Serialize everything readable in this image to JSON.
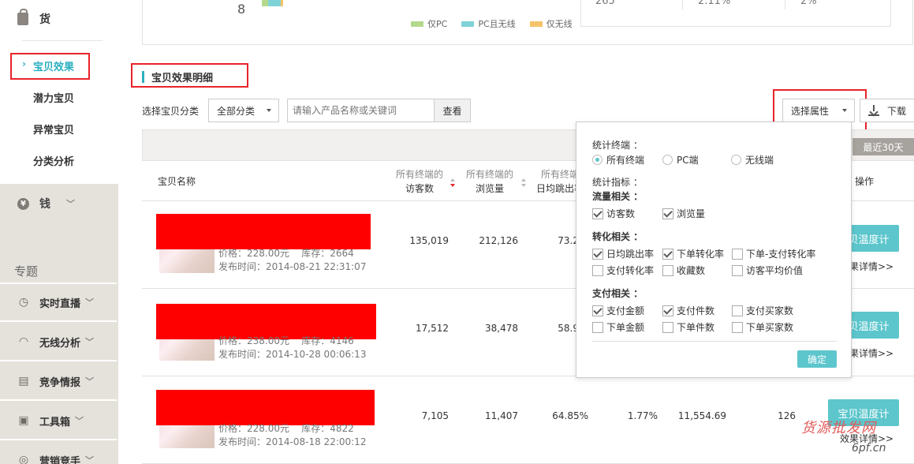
{
  "sidebar": {
    "head_label": "货",
    "items": [
      {
        "label": "宝贝效果",
        "active": true
      },
      {
        "label": "潜力宝贝"
      },
      {
        "label": "异常宝贝"
      },
      {
        "label": "分类分析"
      }
    ],
    "money_label": "钱",
    "coin_glyph": "¥",
    "section_label": "专题",
    "topic_items": [
      {
        "label": "实时直播"
      },
      {
        "label": "无线分析"
      },
      {
        "label": "竞争情报"
      },
      {
        "label": "工具箱"
      },
      {
        "label": "营销竞手"
      }
    ]
  },
  "top_card": {
    "number": "8",
    "legend": [
      {
        "label": "仅PC",
        "color": "#b5d98c"
      },
      {
        "label": "PC且无线",
        "color": "#7fd3d6"
      },
      {
        "label": "仅无线",
        "color": "#f5c36a"
      }
    ],
    "stats": [
      "265",
      "2.11%",
      "2%"
    ]
  },
  "section_title": "宝贝效果明细",
  "filter": {
    "label": "选择宝贝分类",
    "category_value": "全部分类",
    "search_placeholder": "请输入产品名称或关键词",
    "search_button": "查看",
    "attr_button": "选择属性",
    "download_button": "下载"
  },
  "table": {
    "range_tag": "最近30天",
    "headers": {
      "name": "宝贝名称",
      "visitors": [
        "所有终端的",
        "访客数"
      ],
      "pageviews": [
        "所有终端的",
        "浏览量"
      ],
      "bounce": [
        "所有终端",
        "日均跳出率"
      ],
      "ops": "操作"
    },
    "rows": [
      {
        "price": "价格：228.00元",
        "stock": "库存：2664",
        "date": "发布时间：2014-08-21 22:31:07",
        "visitors": "135,019",
        "pageviews": "212,126",
        "bounce": "73.2",
        "conv": "",
        "amount": "",
        "count": "",
        "op_btn": "宝贝温度计",
        "op_link": "效果详情>>"
      },
      {
        "price": "价格：238.00元",
        "stock": "库存：4146",
        "date": "发布时间：2014-10-28 00:06:13",
        "visitors": "17,512",
        "pageviews": "38,478",
        "bounce": "58.9",
        "conv": "",
        "amount": "",
        "count": "",
        "op_btn": "宝贝温度计",
        "op_link": "效果详情>>"
      },
      {
        "price": "价格：228.00元",
        "stock": "库存：4822",
        "date": "发布时间：2014-08-18 22:00:12",
        "visitors": "7,105",
        "pageviews": "11,407",
        "bounce": "64.85%",
        "conv": "1.77%",
        "amount": "11,554.69",
        "count": "126",
        "op_btn": "宝贝温度计",
        "op_link": "效果详情>>"
      }
    ]
  },
  "popup": {
    "terminal_label": "统计终端 ：",
    "terminals": [
      {
        "label": "所有终端",
        "checked": true
      },
      {
        "label": "PC端",
        "checked": false
      },
      {
        "label": "无线端",
        "checked": false
      }
    ],
    "metric_label": "统计指标 ：",
    "groups": [
      {
        "title": "流量相关 ：",
        "items": [
          {
            "label": "访客数",
            "checked": true
          },
          {
            "label": "浏览量",
            "checked": true
          }
        ]
      },
      {
        "title": "转化相关 ：",
        "items": [
          {
            "label": "日均跳出率",
            "checked": true
          },
          {
            "label": "下单转化率",
            "checked": true
          },
          {
            "label": "下单-支付转化率",
            "checked": false
          },
          {
            "label": "支付转化率",
            "checked": false
          },
          {
            "label": "收藏数",
            "checked": false
          },
          {
            "label": "访客平均价值",
            "checked": false
          }
        ]
      },
      {
        "title": "支付相关 ：",
        "items": [
          {
            "label": "支付金额",
            "checked": true
          },
          {
            "label": "支付件数",
            "checked": true
          },
          {
            "label": "支付买家数",
            "checked": false
          },
          {
            "label": "下单金额",
            "checked": false
          },
          {
            "label": "下单件数",
            "checked": false
          },
          {
            "label": "下单买家数",
            "checked": false
          }
        ]
      }
    ],
    "ok_button": "确定"
  },
  "watermark": {
    "line1": "货源批发网",
    "line2": "6pf.cn"
  }
}
